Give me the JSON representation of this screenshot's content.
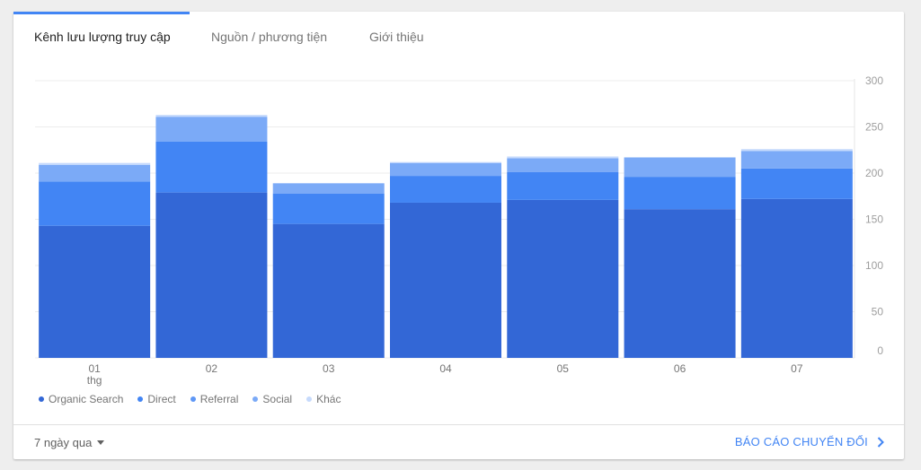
{
  "tabs": [
    {
      "label": "Kênh lưu lượng truy cập",
      "active": true
    },
    {
      "label": "Nguồn / phương tiện",
      "active": false
    },
    {
      "label": "Giới thiệu",
      "active": false
    }
  ],
  "chart_data": {
    "type": "bar",
    "stacked": true,
    "categories": [
      "01",
      "02",
      "03",
      "04",
      "05",
      "06",
      "07"
    ],
    "category_sublabels": [
      "thg",
      "",
      "",
      "",
      "",
      "",
      ""
    ],
    "y_ticks": [
      "300",
      "250",
      "200",
      "150",
      "100",
      "50",
      "0"
    ],
    "series": [
      {
        "name": "Organic Search",
        "color": "#3367d6",
        "values": [
          143,
          179,
          145,
          168,
          171,
          161,
          172
        ]
      },
      {
        "name": "Direct",
        "color": "#4285f4",
        "values": [
          48,
          55,
          33,
          29,
          30,
          35,
          33
        ]
      },
      {
        "name": "Referral",
        "color": "#5e97f6",
        "values": [
          0,
          0,
          0,
          0,
          0,
          0,
          0
        ]
      },
      {
        "name": "Social",
        "color": "#7baaf7",
        "values": [
          18,
          27,
          11,
          14,
          15,
          21,
          19
        ]
      },
      {
        "name": "Khác",
        "color": "#c6dafc",
        "values": [
          2,
          2,
          0,
          1,
          2,
          0,
          2
        ]
      }
    ],
    "grid": true,
    "legend_position": "bottom-left"
  },
  "footer": {
    "range_label": "7 ngày qua",
    "report_link": "BÁO CÁO CHUYỂN ĐỔI"
  }
}
